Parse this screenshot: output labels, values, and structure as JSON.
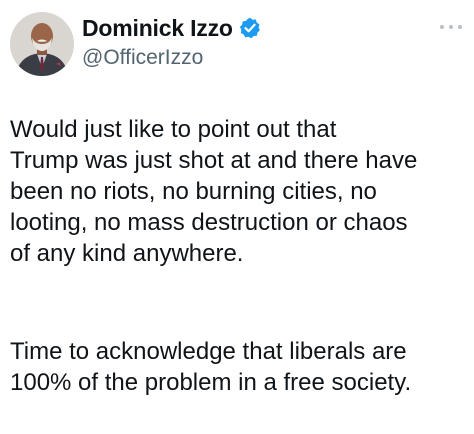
{
  "author": {
    "display_name": "Dominick Izzo",
    "handle": "@OfficerIzzo",
    "verified": true,
    "verified_color": "#1d9bf0",
    "avatar_icon": "profile-photo"
  },
  "menu": {
    "icon": "more-horizontal-icon"
  },
  "tweet": {
    "paragraph_1": "Would just like to point out that\nTrump was just shot at and there have\nbeen no riots, no burning cities, no\nlooting, no mass destruction or chaos\nof any kind anywhere.",
    "paragraph_2": "Time to acknowledge that liberals are\n100% of the problem in a free society."
  }
}
